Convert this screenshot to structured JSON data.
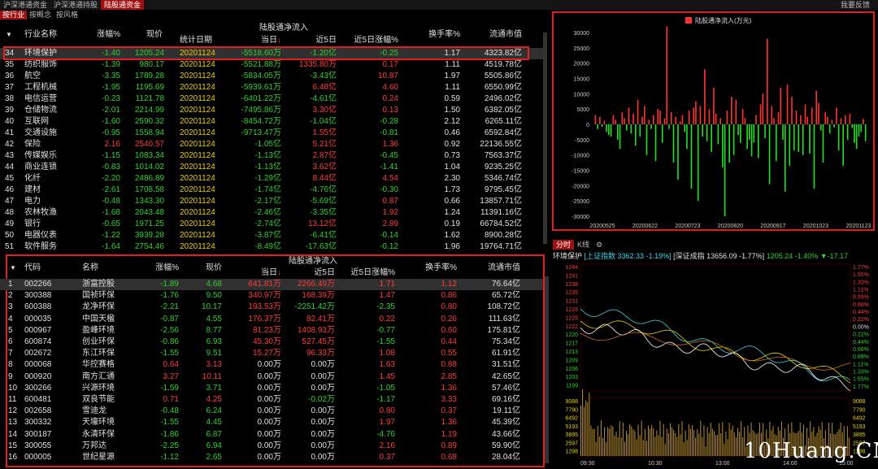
{
  "topnav": {
    "tabs": [
      "沪深港通资金",
      "沪深港通持股",
      "陆股通资金"
    ],
    "active": 2,
    "feedback": "我要反馈"
  },
  "subnav": {
    "tabs": [
      "按行业",
      "按概念",
      "按风格"
    ],
    "active": 0
  },
  "industry": {
    "headers": {
      "name": "行业名称",
      "chg": "涨幅%",
      "price": "现价",
      "date": "统计日期",
      "group": "陆股通净流入",
      "today": "当日",
      "d5": "近5日",
      "d5chg": "近5日涨幅%",
      "turnover": "换手率%",
      "mcap": "流通市值"
    },
    "rows": [
      [
        "34",
        "环境保护",
        "-1.40",
        "1205.24",
        "20201124",
        "-5518.60万",
        "-1.20亿",
        "-0.25",
        "1.17",
        "4323.82亿"
      ],
      [
        "35",
        "纺织服饰",
        "-1.39",
        "980.17",
        "20201124",
        "-5521.88万",
        "1335.80万",
        "0.17",
        "1.11",
        "4519.78亿"
      ],
      [
        "36",
        "航空",
        "-3.35",
        "1789.28",
        "20201124",
        "-5834.05万",
        "-3.43亿",
        "10.87",
        "1.97",
        "5505.86亿"
      ],
      [
        "37",
        "工程机械",
        "-1.95",
        "1195.69",
        "20201124",
        "-5939.61万",
        "6.48亿",
        "4.60",
        "1.11",
        "6550.99亿"
      ],
      [
        "38",
        "电信运营",
        "-0.23",
        "1121.78",
        "20201124",
        "-6401.22万",
        "-4.61亿",
        "0.24",
        "0.59",
        "2496.02亿"
      ],
      [
        "39",
        "仓储物流",
        "-2.01",
        "2214.99",
        "20201124",
        "-7495.86万",
        "3.30亿",
        "0.13",
        "1.50",
        "6382.05亿"
      ],
      [
        "40",
        "互联网",
        "-1.60",
        "2590.32",
        "20201124",
        "-8454.72万",
        "-1.04亿",
        "-0.28",
        "2.12",
        "6265.11亿"
      ],
      [
        "41",
        "交通设施",
        "-0.95",
        "1558.94",
        "20201124",
        "-9713.47万",
        "1.55亿",
        "-0.81",
        "0.46",
        "6592.84亿"
      ],
      [
        "42",
        "保险",
        "2.16",
        "2540.57",
        "20201124",
        "-1.05亿",
        "5.21亿",
        "1.36",
        "0.92",
        "22136.55亿"
      ],
      [
        "43",
        "传媒娱乐",
        "-1.15",
        "1083.34",
        "20201124",
        "-1.13亿",
        "2.87亿",
        "-0.45",
        "0.73",
        "7563.37亿"
      ],
      [
        "44",
        "商业连锁",
        "-0.83",
        "1014.02",
        "20201124",
        "-1.13亿",
        "3.62亿",
        "-1.41",
        "1.04",
        "9235.25亿"
      ],
      [
        "45",
        "化纤",
        "-2.20",
        "2486.89",
        "20201124",
        "-1.29亿",
        "8.44亿",
        "4.54",
        "2.30",
        "5346.74亿"
      ],
      [
        "46",
        "建材",
        "-2.61",
        "1708.58",
        "20201124",
        "-1.74亿",
        "-4.76亿",
        "-0.30",
        "1.73",
        "9795.45亿"
      ],
      [
        "47",
        "电力",
        "-0.48",
        "1343.30",
        "20201124",
        "-2.17亿",
        "-5.69亿",
        "0.87",
        "0.66",
        "13857.71亿"
      ],
      [
        "48",
        "农林牧渔",
        "-1.68",
        "2043.48",
        "20201124",
        "-2.46亿",
        "-3.35亿",
        "1.92",
        "1.24",
        "11391.16亿"
      ],
      [
        "49",
        "银行",
        "-0.65",
        "1971.25",
        "20201124",
        "-2.74亿",
        "13.12亿",
        "2.89",
        "0.19",
        "66784.52亿"
      ],
      [
        "50",
        "电器仪表",
        "-1.22",
        "3939.28",
        "20201124",
        "-3.87亿",
        "-6.41亿",
        "-0.14",
        "1.62",
        "8900.28亿"
      ],
      [
        "51",
        "软件服务",
        "-1.64",
        "2754.46",
        "20201124",
        "-8.49亿",
        "-17.63亿",
        "-0.12",
        "1.96",
        "19764.71亿"
      ]
    ]
  },
  "stocks": {
    "headers": {
      "code": "代码",
      "name": "名称",
      "chg": "涨幅%",
      "price": "现价",
      "group": "陆股通净流入",
      "today": "当日",
      "d5": "近5日",
      "d5chg": "近5日涨幅%",
      "turnover": "换手率%",
      "mcap": "流通市值"
    },
    "rows": [
      [
        "1",
        "002266",
        "浙富控股",
        "-1.89",
        "4.68",
        "641.81万",
        "2266.49万",
        "1.71",
        "1.12",
        "76.64亿"
      ],
      [
        "2",
        "300388",
        "国祯环保",
        "-1.76",
        "9.50",
        "340.97万",
        "168.39万",
        "1.47",
        "0.86",
        "65.72亿"
      ],
      [
        "3",
        "600388",
        "龙净环保",
        "-2.21",
        "10.17",
        "193.53万",
        "-2251.42万",
        "-2.35",
        "0.80",
        "108.72亿"
      ],
      [
        "4",
        "000035",
        "中国天楹",
        "-0.87",
        "4.55",
        "176.37万",
        "82.41万",
        "0.22",
        "0.26",
        "111.63亿"
      ],
      [
        "5",
        "000967",
        "盈峰环境",
        "-2.56",
        "8.77",
        "81.23万",
        "1408.93万",
        "-0.77",
        "0.60",
        "175.81亿"
      ],
      [
        "6",
        "600874",
        "创业环保",
        "-0.86",
        "6.93",
        "45.30万",
        "527.45万",
        "-1.55",
        "0.44",
        "75.34亿"
      ],
      [
        "7",
        "002672",
        "东江环保",
        "-1.55",
        "9.51",
        "15.27万",
        "96.33万",
        "1.08",
        "0.55",
        "61.91亿"
      ],
      [
        "8",
        "000068",
        "华控赛格",
        "0.64",
        "3.13",
        "0.00万",
        "0.00万",
        "1.63",
        "0.88",
        "31.51亿"
      ],
      [
        "9",
        "000920",
        "南方汇通",
        "3.27",
        "10.11",
        "0.00万",
        "0.00万",
        "1.45",
        "2.85",
        "42.65亿"
      ],
      [
        "10",
        "300266",
        "兴源环境",
        "-1.59",
        "3.71",
        "0.00万",
        "0.00万",
        "-1.05",
        "1.36",
        "57.46亿"
      ],
      [
        "11",
        "600481",
        "双良节能",
        "0.71",
        "4.25",
        "0.00万",
        "-0.02万",
        "-1.17",
        "3.33",
        "69.16亿"
      ],
      [
        "12",
        "002658",
        "雪迪龙",
        "-0.48",
        "6.24",
        "0.00万",
        "0.00万",
        "0.80",
        "0.37",
        "19.11亿"
      ],
      [
        "13",
        "300332",
        "天壕环境",
        "-1.55",
        "4.45",
        "0.00万",
        "0.00万",
        "1.97",
        "1.36",
        "45.39亿"
      ],
      [
        "14",
        "300187",
        "永清环保",
        "-1.86",
        "6.87",
        "0.00万",
        "0.00万",
        "-4.76",
        "1.19",
        "43.66亿"
      ],
      [
        "15",
        "300055",
        "万邦达",
        "-2.25",
        "6.94",
        "0.00万",
        "0.00万",
        "2.16",
        "0.89",
        "59.90亿"
      ],
      [
        "16",
        "000005",
        "世纪星源",
        "-1.12",
        "2.65",
        "0.00万",
        "0.00万",
        "0.37",
        "0.68",
        "28.04亿"
      ]
    ]
  },
  "chart_data": {
    "type": "bar",
    "legend": "陆股通净流入(万元)",
    "ylim": [
      -30000,
      30000
    ],
    "yticks": [
      30000,
      25000,
      20000,
      15000,
      10000,
      5000,
      0,
      -5000,
      -10000,
      -15000,
      -20000,
      -25000,
      -30000
    ],
    "xticks": [
      "20200525",
      "20200622",
      "20200723",
      "20200820",
      "20200917",
      "20201023",
      "20201123"
    ],
    "values": [
      3000,
      -1500,
      2500,
      -800,
      1200,
      -2500,
      -3500,
      -4000,
      3000,
      1500,
      -5000,
      -8000,
      4000,
      2000,
      -2000,
      5500,
      -3000,
      3500,
      -7000,
      8000,
      -4000,
      2500,
      6000,
      -10000,
      1500,
      -1500,
      3000,
      -12000,
      5000,
      4500,
      -6000,
      2000,
      32000,
      -1500,
      4000,
      -12500,
      2500,
      -18000,
      1000,
      3000,
      -2500,
      -8000,
      4500,
      -21000,
      5500,
      7500,
      -25000,
      6000,
      -4000,
      18000,
      -5500,
      5000,
      -9000,
      12000,
      3500,
      -6500,
      2000,
      -14000,
      -30000,
      4500,
      -12500,
      9000,
      -10000,
      8000,
      -3500,
      -6000,
      5000,
      2000,
      -8000,
      -5000,
      -10500,
      -6000,
      3000,
      -11000,
      6500,
      10000,
      -4500,
      28000,
      -19500,
      6000,
      2000,
      -12000,
      4000,
      12000,
      -5000,
      -22000,
      13000,
      -13500,
      9000,
      -8500,
      4500,
      -9000,
      3000,
      -10000,
      6500,
      2500,
      -9500,
      5500,
      -21000,
      11000,
      7000,
      -2000,
      -12500,
      4000,
      2500,
      -3000,
      1500,
      -1000,
      5500,
      -8500,
      2000,
      -13500,
      3000,
      -5000,
      3500,
      -1200,
      -6000,
      -8000,
      -4000,
      -2500,
      1800,
      -5500
    ],
    "colors": {
      "pos": "#ff3030",
      "neg": "#22dd22"
    }
  },
  "intraday": {
    "tabs": [
      "分时",
      "K线"
    ],
    "info_name": "环境保护",
    "info_sh": "[上证指数 3362.33 -1.19%]",
    "info_sz": "[深证成指 13656.09 -1.77%]",
    "info_price": "1205.24 -1.40% ▼-17.17",
    "price_left": [
      "1244",
      "1241",
      "1238",
      "1235",
      "1231",
      "1228",
      "1225",
      "1222",
      "1220",
      "1217",
      "1213",
      "1209",
      "1206",
      "1203",
      "1199"
    ],
    "pct_right": [
      "1.77%",
      "1.55%",
      "1.33%",
      "1.11%",
      "0.89%",
      "0.66%",
      "0.44%",
      "0.22%",
      "0.00%",
      "0.22%",
      "0.44%",
      "0.66%",
      "0.89%",
      "1.11%",
      "1.33%",
      "1.55%",
      "1.77%"
    ],
    "vol_left": [
      "9088",
      "7790",
      "6492",
      "5193",
      "3895",
      "2597",
      "1298"
    ],
    "vol_right": [
      "9088",
      "7790",
      "6492",
      "5193",
      "3895",
      "2597",
      "1298"
    ],
    "time_ticks": [
      "09:30",
      "10:30",
      "13:00",
      "14:00",
      "15:00"
    ]
  },
  "watermark": "10Huang.CN"
}
